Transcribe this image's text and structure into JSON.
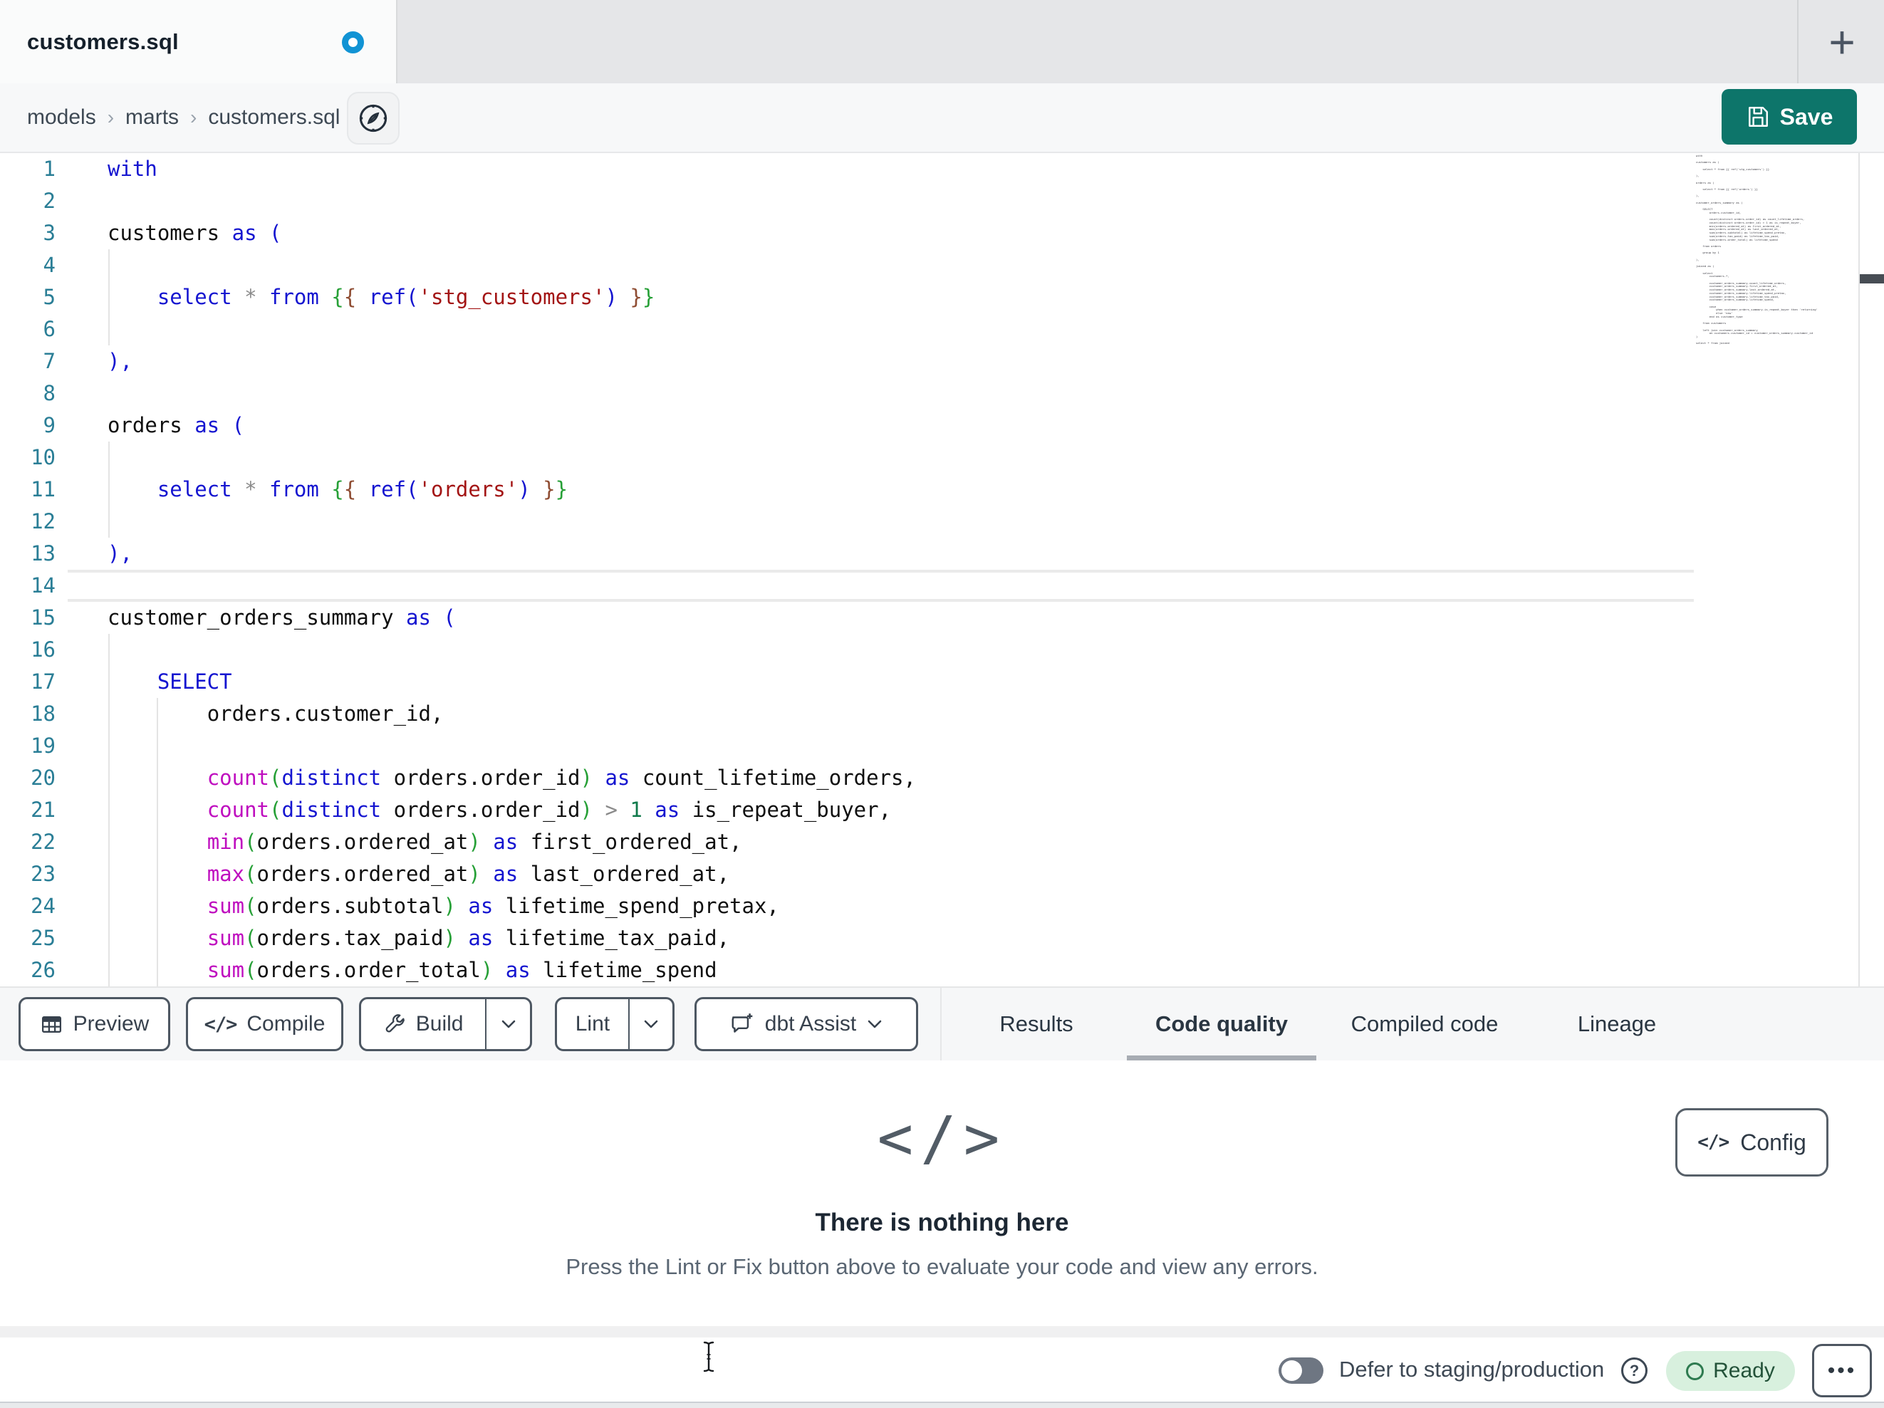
{
  "window": {
    "tab_title": "customers.sql",
    "new_tab_label": "+"
  },
  "breadcrumb": {
    "items": [
      "models",
      "marts",
      "customers.sql"
    ],
    "separator": "›"
  },
  "header": {
    "save_label": "Save"
  },
  "editor": {
    "active_line": 14,
    "lines": [
      {
        "n": 1,
        "t": [
          [
            "kw",
            "with"
          ]
        ]
      },
      {
        "n": 2,
        "t": []
      },
      {
        "n": 3,
        "t": [
          [
            "id",
            "customers "
          ],
          [
            "kw",
            "as ("
          ]
        ]
      },
      {
        "n": 4,
        "t": []
      },
      {
        "n": 5,
        "t": [
          [
            "pl",
            "    "
          ],
          [
            "kw",
            "select "
          ],
          [
            "op",
            "* "
          ],
          [
            "kw",
            "from "
          ],
          [
            "br1",
            "{"
          ],
          [
            "br2",
            "{"
          ],
          [
            "pl",
            " "
          ],
          [
            "kw",
            "ref("
          ],
          [
            "str",
            "'stg_customers'"
          ],
          [
            "kw",
            ")"
          ],
          [
            "pl",
            " "
          ],
          [
            "br2",
            "}"
          ],
          [
            "br1",
            "}"
          ]
        ]
      },
      {
        "n": 6,
        "t": []
      },
      {
        "n": 7,
        "t": [
          [
            "kw",
            "),"
          ]
        ]
      },
      {
        "n": 8,
        "t": []
      },
      {
        "n": 9,
        "t": [
          [
            "id",
            "orders "
          ],
          [
            "kw",
            "as ("
          ]
        ]
      },
      {
        "n": 10,
        "t": []
      },
      {
        "n": 11,
        "t": [
          [
            "pl",
            "    "
          ],
          [
            "kw",
            "select "
          ],
          [
            "op",
            "* "
          ],
          [
            "kw",
            "from "
          ],
          [
            "br1",
            "{"
          ],
          [
            "br2",
            "{"
          ],
          [
            "pl",
            " "
          ],
          [
            "kw",
            "ref("
          ],
          [
            "str",
            "'orders'"
          ],
          [
            "kw",
            ")"
          ],
          [
            "pl",
            " "
          ],
          [
            "br2",
            "}"
          ],
          [
            "br1",
            "}"
          ]
        ]
      },
      {
        "n": 12,
        "t": []
      },
      {
        "n": 13,
        "t": [
          [
            "kw",
            "),"
          ]
        ]
      },
      {
        "n": 14,
        "t": []
      },
      {
        "n": 15,
        "t": [
          [
            "id",
            "customer_orders_summary "
          ],
          [
            "kw",
            "as ("
          ]
        ]
      },
      {
        "n": 16,
        "t": []
      },
      {
        "n": 17,
        "t": [
          [
            "pl",
            "    "
          ],
          [
            "kw",
            "SELECT"
          ]
        ]
      },
      {
        "n": 18,
        "t": [
          [
            "pl",
            "        "
          ],
          [
            "id",
            "orders.customer_id,"
          ]
        ]
      },
      {
        "n": 19,
        "t": []
      },
      {
        "n": 20,
        "t": [
          [
            "pl",
            "        "
          ],
          [
            "fn",
            "count"
          ],
          [
            "br1",
            "("
          ],
          [
            "kw",
            "distinct "
          ],
          [
            "id",
            "orders.order_id"
          ],
          [
            "br1",
            ")"
          ],
          [
            "pl",
            " "
          ],
          [
            "kw",
            "as "
          ],
          [
            "id",
            "count_lifetime_orders,"
          ]
        ]
      },
      {
        "n": 21,
        "t": [
          [
            "pl",
            "        "
          ],
          [
            "fn",
            "count"
          ],
          [
            "br1",
            "("
          ],
          [
            "kw",
            "distinct "
          ],
          [
            "id",
            "orders.order_id"
          ],
          [
            "br1",
            ")"
          ],
          [
            "pl",
            " "
          ],
          [
            "op",
            "> "
          ],
          [
            "num",
            "1 "
          ],
          [
            "kw",
            "as "
          ],
          [
            "id",
            "is_repeat_buyer,"
          ]
        ]
      },
      {
        "n": 22,
        "t": [
          [
            "pl",
            "        "
          ],
          [
            "fn",
            "min"
          ],
          [
            "br1",
            "("
          ],
          [
            "id",
            "orders.ordered_at"
          ],
          [
            "br1",
            ")"
          ],
          [
            "pl",
            " "
          ],
          [
            "kw",
            "as "
          ],
          [
            "id",
            "first_ordered_at,"
          ]
        ]
      },
      {
        "n": 23,
        "t": [
          [
            "pl",
            "        "
          ],
          [
            "fn",
            "max"
          ],
          [
            "br1",
            "("
          ],
          [
            "id",
            "orders.ordered_at"
          ],
          [
            "br1",
            ")"
          ],
          [
            "pl",
            " "
          ],
          [
            "kw",
            "as "
          ],
          [
            "id",
            "last_ordered_at,"
          ]
        ]
      },
      {
        "n": 24,
        "t": [
          [
            "pl",
            "        "
          ],
          [
            "fn",
            "sum"
          ],
          [
            "br1",
            "("
          ],
          [
            "id",
            "orders.subtotal"
          ],
          [
            "br1",
            ")"
          ],
          [
            "pl",
            " "
          ],
          [
            "kw",
            "as "
          ],
          [
            "id",
            "lifetime_spend_pretax,"
          ]
        ]
      },
      {
        "n": 25,
        "t": [
          [
            "pl",
            "        "
          ],
          [
            "fn",
            "sum"
          ],
          [
            "br1",
            "("
          ],
          [
            "id",
            "orders.tax_paid"
          ],
          [
            "br1",
            ")"
          ],
          [
            "pl",
            " "
          ],
          [
            "kw",
            "as "
          ],
          [
            "id",
            "lifetime_tax_paid,"
          ]
        ]
      },
      {
        "n": 26,
        "t": [
          [
            "pl",
            "        "
          ],
          [
            "fn",
            "sum"
          ],
          [
            "br1",
            "("
          ],
          [
            "id",
            "orders.order_total"
          ],
          [
            "br1",
            ")"
          ],
          [
            "pl",
            " "
          ],
          [
            "kw",
            "as "
          ],
          [
            "id",
            "lifetime_spend"
          ]
        ]
      }
    ]
  },
  "minimap": {
    "code": "with\n\ncustomers as (\n\n    select * from {{ ref('stg_customers') }}\n\n),\n\norders as (\n\n    select * from {{ ref('orders') }}\n\n),\n\ncustomer_orders_summary as (\n\n    SELECT\n        orders.customer_id,\n\n        count(distinct orders.order_id) as count_lifetime_orders,\n        count(distinct orders.order_id) > 1 as is_repeat_buyer,\n        min(orders.ordered_at) as first_ordered_at,\n        max(orders.ordered_at) as last_ordered_at,\n        sum(orders.subtotal) as lifetime_spend_pretax,\n        sum(orders.tax_paid) as lifetime_tax_paid,\n        sum(orders.order_total) as lifetime_spend\n\n    from orders\n\n    group by 1\n\n),\n\njoined as (\n\n    select\n        customers.*,\n\n        customer_orders_summary.count_lifetime_orders,\n        customer_orders_summary.first_ordered_at,\n        customer_orders_summary.last_ordered_at,\n        customer_orders_summary.lifetime_spend_pretax,\n        customer_orders_summary.lifetime_tax_paid,\n        customer_orders_summary.lifetime_spend,\n\n        case\n            when customer_orders_summary.is_repeat_buyer then 'returning'\n            else 'new'\n        end as customer_type\n\n    from customers\n\n    left join customer_orders_summary\n        on customers.customer_id = customer_orders_summary.customer_id\n)\n\nselect * from joined"
  },
  "toolbar": {
    "preview_label": "Preview",
    "compile_label": "Compile",
    "build_label": "Build",
    "lint_label": "Lint",
    "assist_label": "dbt Assist",
    "compile_glyph": "</>"
  },
  "tabs": [
    {
      "label": "Results",
      "active": false
    },
    {
      "label": "Code quality",
      "active": true
    },
    {
      "label": "Compiled code",
      "active": false
    },
    {
      "label": "Lineage",
      "active": false
    }
  ],
  "results_panel": {
    "config_label": "Config",
    "config_glyph": "</>",
    "empty_glyph": "</>",
    "empty_title": "There is nothing here",
    "empty_subtitle": "Press the Lint or Fix button above to evaluate your code and view any errors."
  },
  "statusbar": {
    "defer_label": "Defer to staging/production",
    "help_glyph": "?",
    "ready_label": "Ready",
    "more_glyph": "•••"
  },
  "colors": {
    "accent_teal": "#0d756a",
    "unsaved_dot_blue": "#1193d4",
    "ready_badge_bg": "#d8f0de",
    "ready_badge_text": "#235239",
    "keyword_blue": "#1515d0",
    "function_magenta": "#bf0ebf",
    "string_red": "#a31515",
    "line_number_teal": "#2a7e96"
  }
}
